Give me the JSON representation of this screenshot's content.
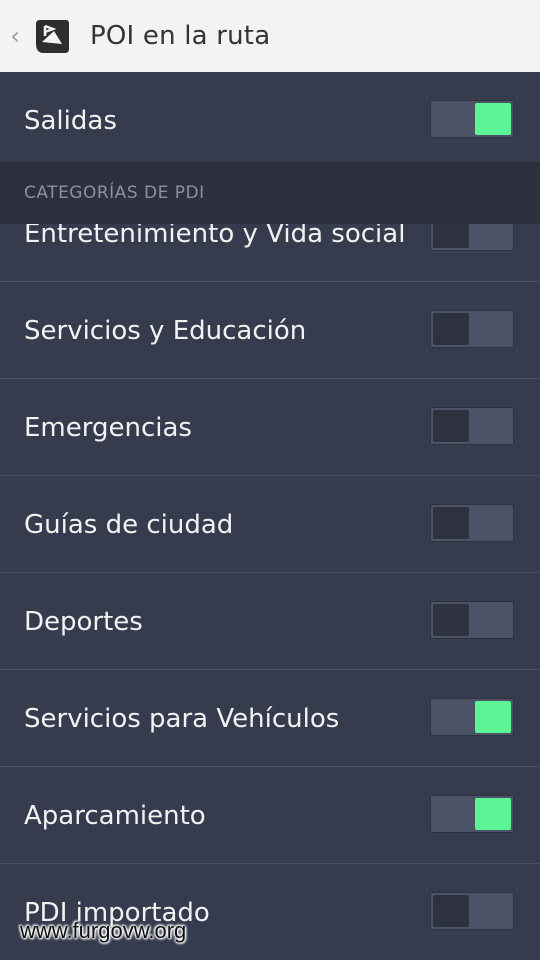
{
  "header": {
    "back_glyph": "‹",
    "logo_icon": "navigation-app-icon",
    "title": "POI en la ruta"
  },
  "top_setting": {
    "label": "Salidas",
    "on": true
  },
  "section": {
    "title": "CATEGORÍAS DE PDI"
  },
  "categories": [
    {
      "label": "Entretenimiento y Vida social",
      "on": false
    },
    {
      "label": "Servicios y Educación",
      "on": false
    },
    {
      "label": "Emergencias",
      "on": false
    },
    {
      "label": "Guías de ciudad",
      "on": false
    },
    {
      "label": "Deportes",
      "on": false
    },
    {
      "label": "Servicios para Vehículos",
      "on": true
    },
    {
      "label": "Aparcamiento",
      "on": true
    },
    {
      "label": "PDI importado",
      "on": false
    }
  ],
  "watermark": "www.furgovw.org",
  "colors": {
    "toggle_on": "#5cf595",
    "background": "#363c4d",
    "header_bg": "#f3f3f3"
  }
}
